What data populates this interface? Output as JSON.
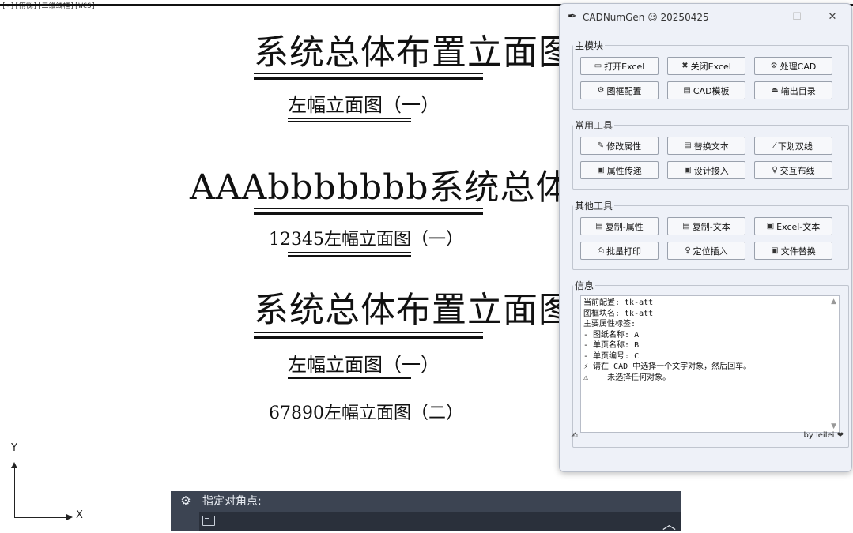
{
  "viewport": {
    "label": "[-][俯视][二维线框][WCS]"
  },
  "drawing": {
    "title1": "系统总体布置立面图",
    "sub1": "左幅立面图（一）",
    "title2": "AAAbbbbbbb系统总体布置立面图",
    "sub2": "12345左幅立面图（一）",
    "title3": "系统总体布置立面图",
    "sub3": "左幅立面图（一）",
    "sub4": "67890左幅立面图（二）"
  },
  "ucs": {
    "x_label": "X",
    "y_label": "Y"
  },
  "command": {
    "prompt": "指定对角点:"
  },
  "window": {
    "icon": "feather-icon",
    "title": "CADNumGen ☺ 20250425",
    "minimize": "—",
    "maximize": "☐",
    "close": "✕"
  },
  "groups": {
    "main": {
      "label": "主模块",
      "buttons": [
        {
          "icon": "▭",
          "label": "打开Excel"
        },
        {
          "icon": "✖",
          "label": "关闭Excel"
        },
        {
          "icon": "⚙",
          "label": "处理CAD"
        },
        {
          "icon": "⚙",
          "label": "图框配置"
        },
        {
          "icon": "▤",
          "label": "CAD模板"
        },
        {
          "icon": "⏏",
          "label": "输出目录"
        }
      ]
    },
    "common": {
      "label": "常用工具",
      "buttons": [
        {
          "icon": "✎",
          "label": "修改属性"
        },
        {
          "icon": "▤",
          "label": "替换文本"
        },
        {
          "icon": "⁄",
          "label": "下划双线"
        },
        {
          "icon": "▣",
          "label": "属性传递"
        },
        {
          "icon": "▣",
          "label": "设计接入"
        },
        {
          "icon": "♀",
          "label": "交互布线"
        }
      ]
    },
    "other": {
      "label": "其他工具",
      "buttons": [
        {
          "icon": "▤",
          "label": "复制-属性"
        },
        {
          "icon": "▤",
          "label": "复制-文本"
        },
        {
          "icon": "▣",
          "label": "Excel-文本"
        },
        {
          "icon": "⎙",
          "label": "批量打印"
        },
        {
          "icon": "♀",
          "label": "定位插入"
        },
        {
          "icon": "▣",
          "label": "文件替换"
        }
      ]
    },
    "info": {
      "label": "信息",
      "text": "当前配置: tk-att\n图框块名: tk-att\n主要属性标签:\n- 图纸名称: A\n- 单页名称: B\n- 单页编号: C\n⚡ 请在 CAD 中选择一个文字对象，然后回车。\n⚠    未选择任何对象。",
      "scroll_up": "▲",
      "scroll_down": "▼"
    }
  },
  "footer": {
    "pen": "✍",
    "credit": "by leilei",
    "heart": "❤"
  },
  "colors": {
    "window_bg": "#eef1f8",
    "cmd_bar": "#3c4452",
    "button_bg": "#f7f8fb"
  }
}
